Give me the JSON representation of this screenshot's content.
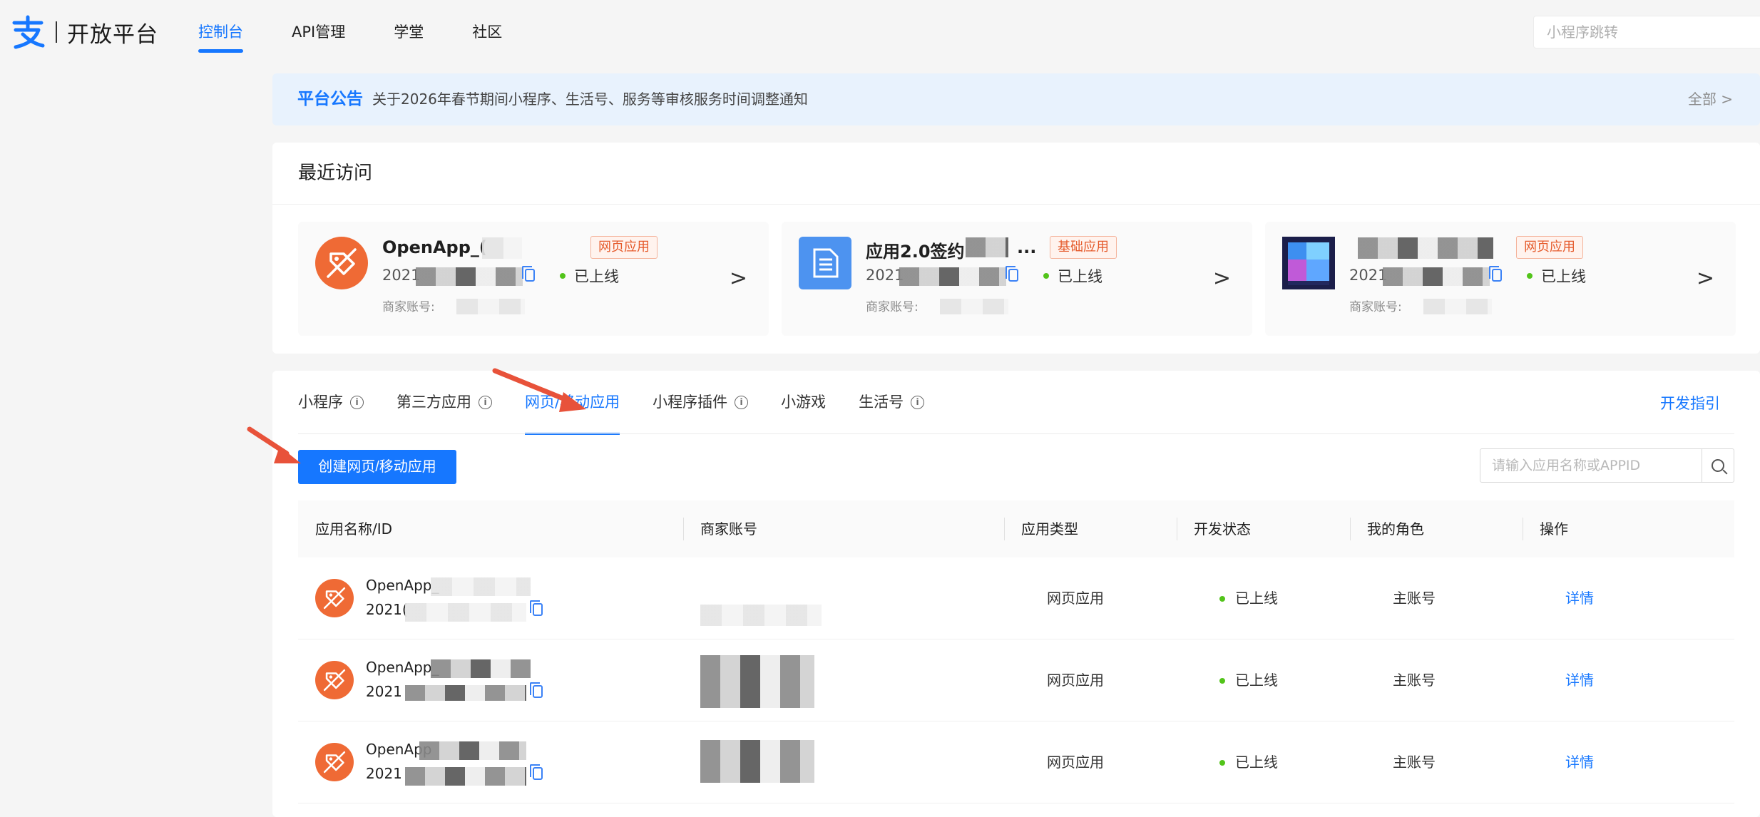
{
  "header": {
    "logo_text": "开放平台",
    "nav": [
      {
        "label": "控制台",
        "active": true
      },
      {
        "label": "API管理",
        "active": false
      },
      {
        "label": "学堂",
        "active": false
      },
      {
        "label": "社区",
        "active": false
      }
    ],
    "search_placeholder": "小程序跳转"
  },
  "notice": {
    "title": "平台公告",
    "text": "关于2026年春节期间小程序、生活号、服务等审核服务时间调整通知",
    "all_label": "全部 >"
  },
  "recent": {
    "title": "最近访问",
    "cards": [
      {
        "name": "OpenApp_(",
        "tag": "网页应用",
        "appid": "2021",
        "status": "已上线",
        "merchant_label": "商家账号:",
        "chevron": ">"
      },
      {
        "name": "应用2.0签约",
        "name_suffix": "...",
        "tag": "基础应用",
        "appid": "2021",
        "status": "已上线",
        "merchant_label": "商家账号:",
        "chevron": ">"
      },
      {
        "name": "",
        "tag": "网页应用",
        "appid": "2021",
        "status": "已上线",
        "merchant_label": "商家账号:",
        "chevron": ">"
      }
    ]
  },
  "apps": {
    "tabs": [
      {
        "label": "小程序",
        "info": true,
        "active": false
      },
      {
        "label": "第三方应用",
        "info": true,
        "active": false
      },
      {
        "label": "网页/移动应用",
        "info": false,
        "active": true
      },
      {
        "label": "小程序插件",
        "info": true,
        "active": false
      },
      {
        "label": "小游戏",
        "info": false,
        "active": false
      },
      {
        "label": "生活号",
        "info": true,
        "active": false
      }
    ],
    "dev_guide": "开发指引",
    "create_button": "创建网页/移动应用",
    "search_placeholder": "请输入应用名称或APPID",
    "columns": [
      "应用名称/ID",
      "商家账号",
      "应用类型",
      "开发状态",
      "我的角色",
      "操作"
    ],
    "rows": [
      {
        "name": "OpenApp_",
        "appid": "2021(",
        "type": "网页应用",
        "status": "已上线",
        "role": "主账号",
        "action": "详情"
      },
      {
        "name": "OpenApp_",
        "appid": "2021",
        "type": "网页应用",
        "status": "已上线",
        "role": "主账号",
        "action": "详情"
      },
      {
        "name": "OpenApp",
        "appid": "2021",
        "type": "网页应用",
        "status": "已上线",
        "role": "主账号",
        "action": "详情"
      }
    ]
  },
  "colors": {
    "primary": "#1677ff",
    "online": "#52c41a",
    "tag_text": "#e55a2b",
    "app_icon": "#ef6a35",
    "annotation_arrow": "#e8523a"
  }
}
